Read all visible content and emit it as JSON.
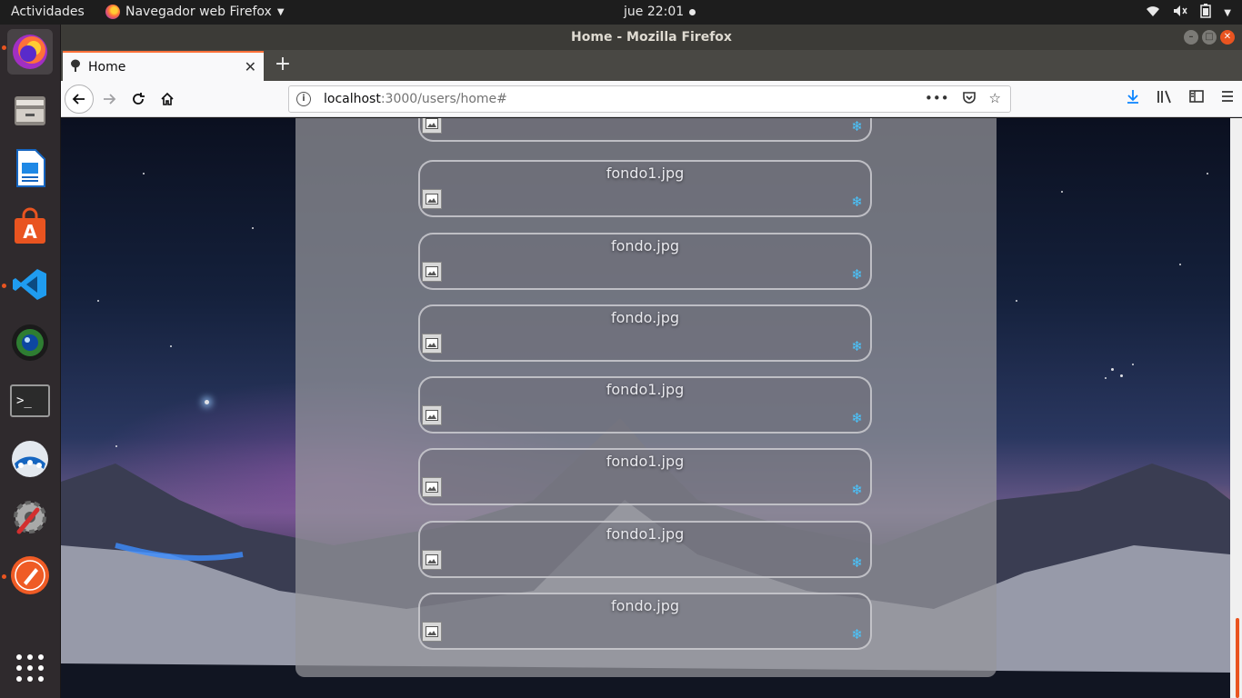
{
  "topbar": {
    "activities": "Actividades",
    "app_menu": "Navegador web Firefox",
    "clock": "jue 22:01"
  },
  "window": {
    "title": "Home - Mozilla Firefox"
  },
  "tab": {
    "title": "Home"
  },
  "urlbar": {
    "host": "localhost",
    "path": ":3000/users/home#"
  },
  "files": [
    {
      "name": ""
    },
    {
      "name": "fondo1.jpg"
    },
    {
      "name": "fondo.jpg"
    },
    {
      "name": "fondo.jpg"
    },
    {
      "name": "fondo1.jpg"
    },
    {
      "name": "fondo1.jpg"
    },
    {
      "name": "fondo1.jpg"
    },
    {
      "name": "fondo.jpg"
    }
  ],
  "icons": {
    "file_thumbnail": "broken-image-icon",
    "snowflake": "❄"
  },
  "colors": {
    "accent": "#e95420",
    "firefox_tab_accent": "#ff7139",
    "snowflake": "#49c6ff"
  }
}
